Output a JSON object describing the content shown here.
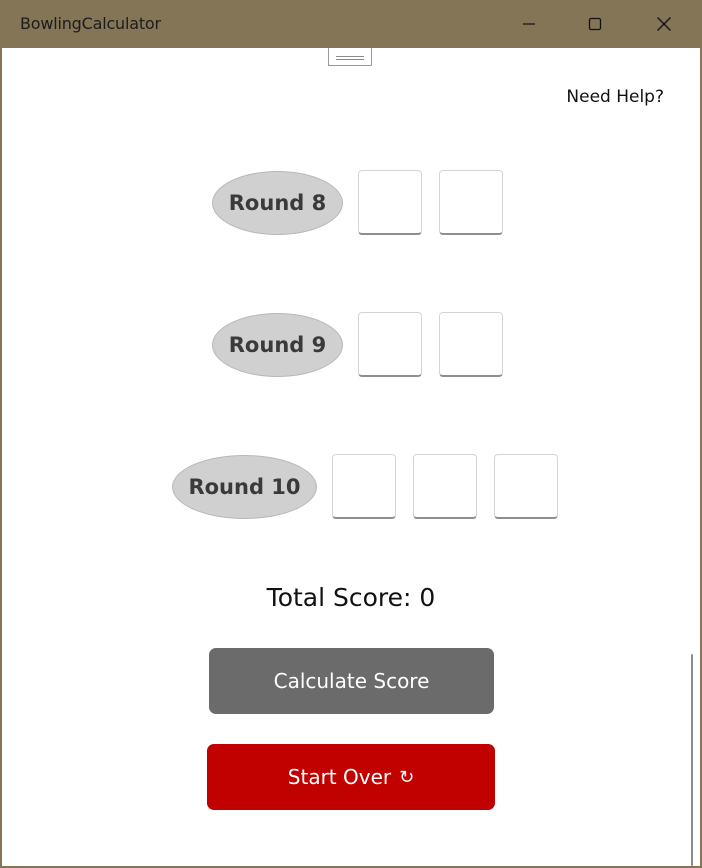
{
  "window": {
    "title": "BowlingCalculator"
  },
  "help_link": "Need Help?",
  "rounds": [
    {
      "label": "Round 8",
      "rolls": [
        "",
        ""
      ]
    },
    {
      "label": "Round 9",
      "rolls": [
        "",
        ""
      ]
    },
    {
      "label": "Round 10",
      "rolls": [
        "",
        "",
        ""
      ]
    }
  ],
  "total_score": "Total Score: 0",
  "buttons": {
    "calculate": "Calculate Score",
    "start_over": "Start Over",
    "start_over_icon": "↻"
  },
  "colors": {
    "titlebar": "#857557",
    "calculate": "#6b6b6b",
    "start_over": "#c10000",
    "round_pill": "#d0d0d0"
  }
}
